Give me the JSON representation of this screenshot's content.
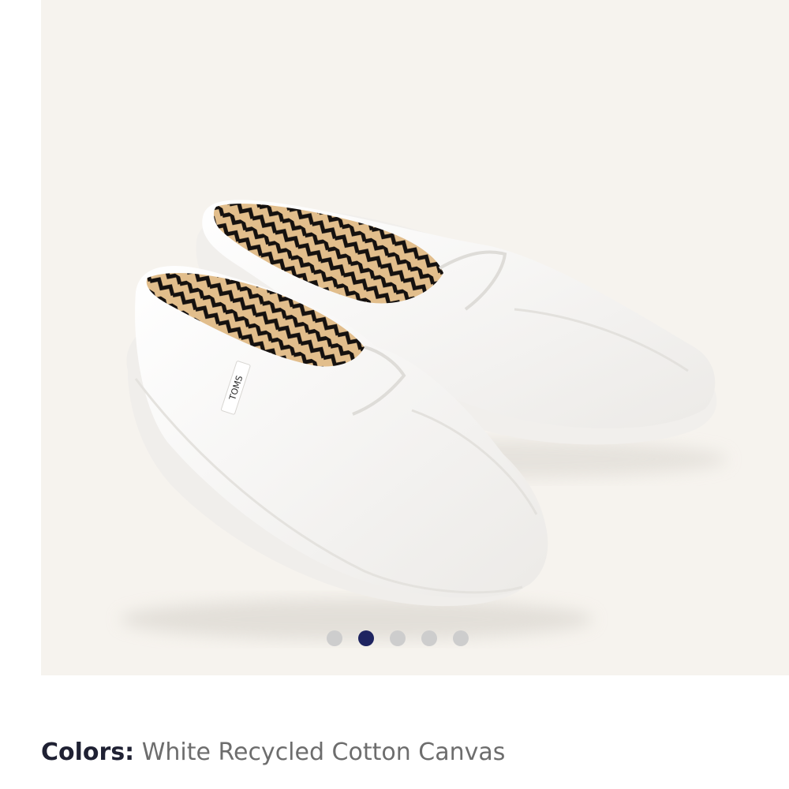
{
  "product": {
    "brand_tag": "TOMS",
    "image_icon": "white-canvas-slip-on-shoes-image"
  },
  "carousel": {
    "dot_count": 5,
    "active_index": 1,
    "active_color": "#1e2460",
    "inactive_color": "#cdcdcd"
  },
  "colors": {
    "label": "Colors:",
    "value": "White Recycled Cotton Canvas"
  },
  "theme": {
    "gallery_background": "#f6f3ee"
  }
}
